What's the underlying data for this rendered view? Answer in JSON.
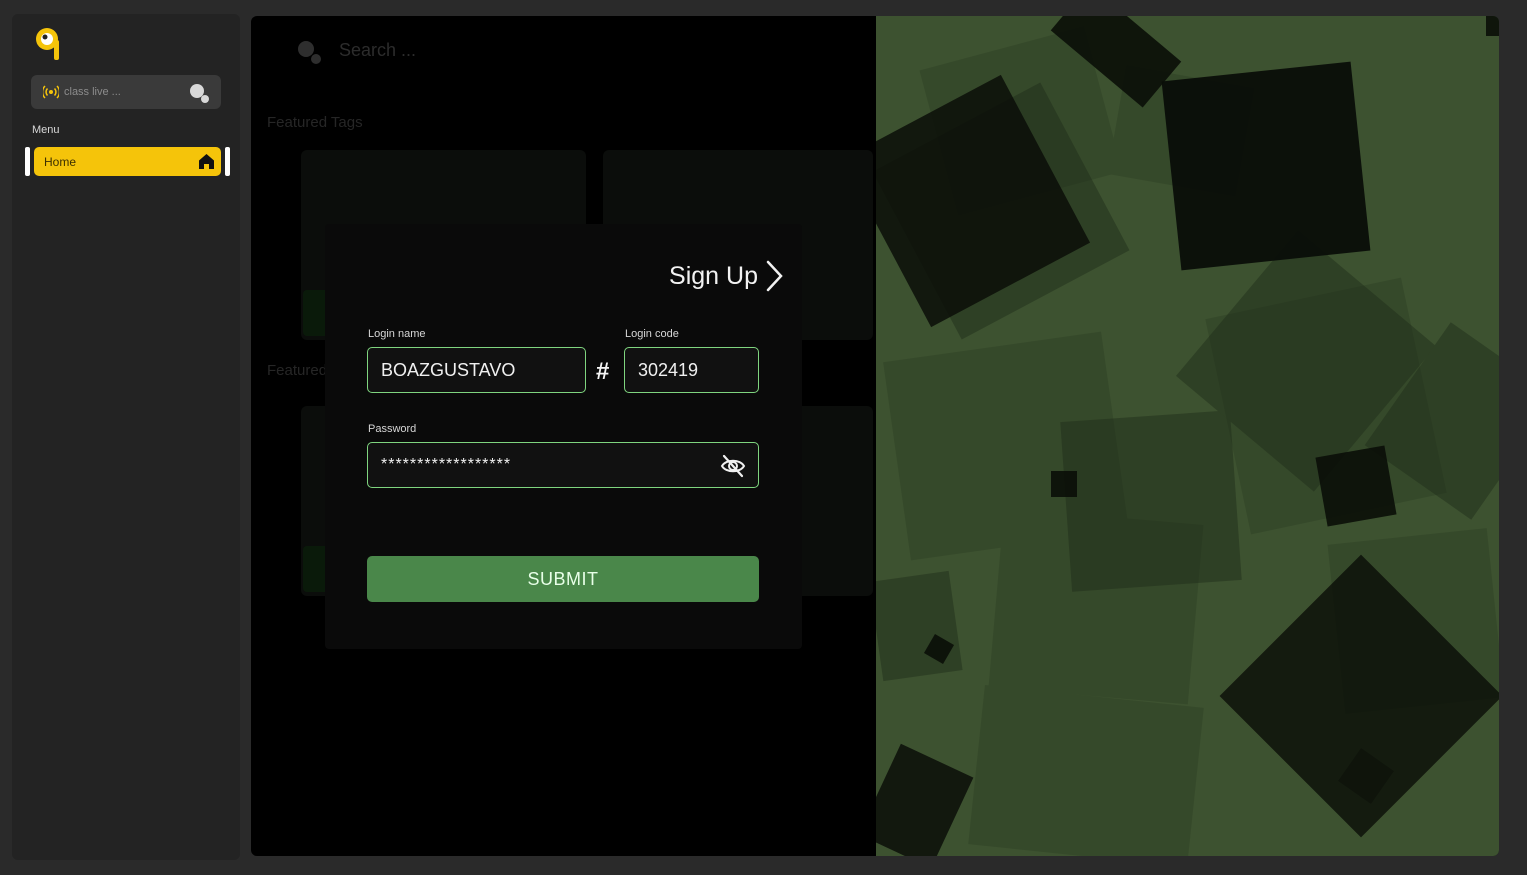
{
  "sidebar": {
    "live_search": {
      "placeholder": "class live ..."
    },
    "menu_label": "Menu",
    "items": [
      {
        "label": "Home",
        "icon": "home-icon",
        "active": true
      }
    ]
  },
  "background": {
    "search_placeholder": "Search ...",
    "section_title_1": "Featured Tags",
    "section_title_2": "Featured"
  },
  "login": {
    "signup_label": "Sign Up",
    "login_name_label": "Login name",
    "login_name_value": "BOAZGUSTAVO",
    "hash": "#",
    "login_code_label": "Login code",
    "login_code_value": "302419",
    "password_label": "Password",
    "password_value": "******************",
    "submit_label": "SUBMIT"
  },
  "colors": {
    "accent_yellow": "#f5c40a",
    "field_border": "#7fd57f",
    "submit_green": "#4a874a",
    "art_green": "#3d5230"
  }
}
